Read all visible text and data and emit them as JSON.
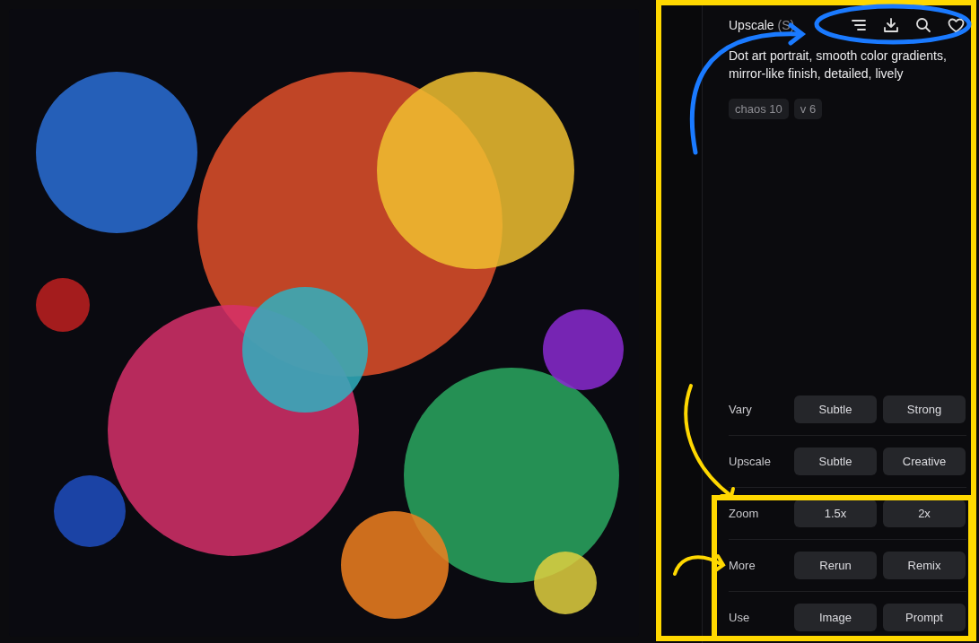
{
  "header": {
    "title": "Upscale",
    "mode": "(S)"
  },
  "prompt": "Dot art portrait, smooth color gradients, mirror-like finish, detailed, lively",
  "tags": [
    "chaos 10",
    "v 6"
  ],
  "actions": [
    {
      "label": "Vary",
      "buttons": [
        "Subtle",
        "Strong"
      ]
    },
    {
      "label": "Upscale",
      "buttons": [
        "Subtle",
        "Creative"
      ]
    },
    {
      "label": "Zoom",
      "buttons": [
        "1.5x",
        "2x"
      ]
    },
    {
      "label": "More",
      "buttons": [
        "Rerun",
        "Remix"
      ]
    },
    {
      "label": "Use",
      "buttons": [
        "Image",
        "Prompt"
      ]
    }
  ]
}
